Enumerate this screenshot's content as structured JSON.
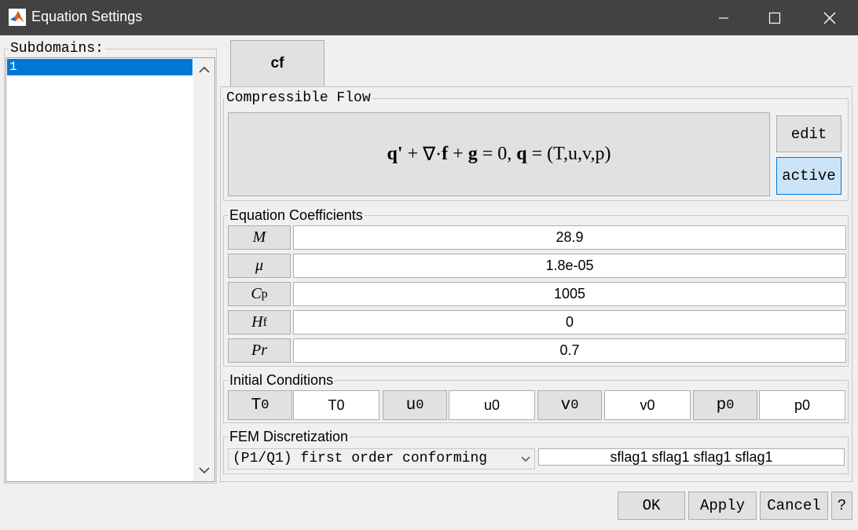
{
  "window": {
    "title": "Equation Settings",
    "controls": [
      "minimize",
      "maximize",
      "close"
    ]
  },
  "subdomains": {
    "label": "Subdomains:",
    "items": [
      "1"
    ],
    "selected": "1"
  },
  "tabs": [
    {
      "label": "cf",
      "selected": true
    }
  ],
  "physics": {
    "group_label": "Compressible Flow",
    "equation": {
      "q_prime": "q",
      "prime": "'",
      "plus1": "+",
      "nabla": "∇·",
      "f": "f",
      "plus2": "+",
      "g": "g",
      "eq_zero": "= 0,",
      "q": "q",
      "eq": "=",
      "vars": "(T,u,v,p)"
    },
    "edit_label": "edit",
    "active_label": "active"
  },
  "coefficients": {
    "group_label": "Equation Coefficients",
    "rows": [
      {
        "symbol": "M",
        "sub": "",
        "value": "28.9"
      },
      {
        "symbol": "μ",
        "sub": "",
        "value": "1.8e-05"
      },
      {
        "symbol": "C",
        "sub": "p",
        "value": "1005"
      },
      {
        "symbol": "H",
        "sub": "f",
        "value": "0"
      },
      {
        "symbol": "Pr",
        "sub": "",
        "value": "0.7"
      }
    ]
  },
  "initial_conditions": {
    "group_label": "Initial Conditions",
    "items": [
      {
        "symbol": "T",
        "sub": "0",
        "value": "T0"
      },
      {
        "symbol": "u",
        "sub": "0",
        "value": "u0"
      },
      {
        "symbol": "v",
        "sub": "0",
        "value": "v0"
      },
      {
        "symbol": "p",
        "sub": "0",
        "value": "p0"
      }
    ]
  },
  "fem": {
    "group_label": "FEM Discretization",
    "selected": "(P1/Q1) first order conforming",
    "flags": "sflag1 sflag1 sflag1 sflag1"
  },
  "buttons": {
    "ok": "OK",
    "apply": "Apply",
    "cancel": "Cancel",
    "help": "?"
  },
  "colors": {
    "titlebar": "#424242",
    "selection": "#0078d7",
    "active_bg": "#cce4f7"
  }
}
